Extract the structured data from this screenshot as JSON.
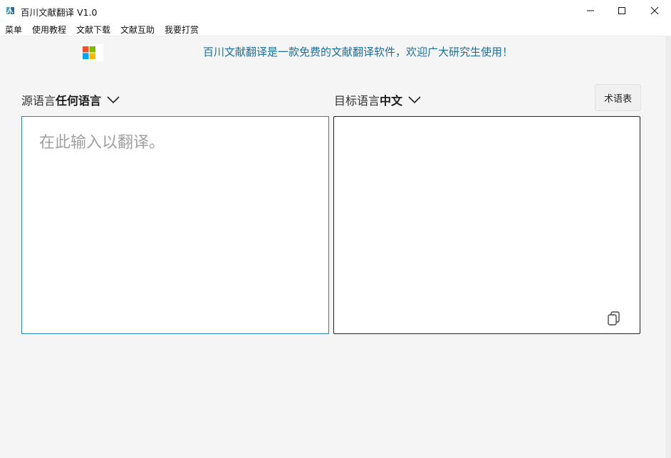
{
  "window": {
    "title": "百川文献翻译 V1.0"
  },
  "menu": {
    "items": [
      "菜单",
      "使用教程",
      "文献下载",
      "文献互助",
      "我要打赏"
    ]
  },
  "banner": {
    "text": "百川文献翻译是一款免费的文献翻译软件，欢迎广大研究生使用！"
  },
  "source": {
    "label": "源语言",
    "value": "任何语言",
    "placeholder": "在此输入以翻译。",
    "text": ""
  },
  "target": {
    "label": "目标语言",
    "value": "中文",
    "text": ""
  },
  "glossary_button": "术语表",
  "colors": {
    "banner_text": "#1f6e98",
    "source_border": "#2f7fbd",
    "background": "#f5f5f5"
  },
  "icons": {
    "app": "book-translate-icon",
    "minimize": "minimize-icon",
    "maximize": "maximize-icon",
    "close": "close-icon",
    "logo": "windows-logo-icon",
    "dropdown": "chevron-down-icon",
    "copy": "copy-icon"
  }
}
